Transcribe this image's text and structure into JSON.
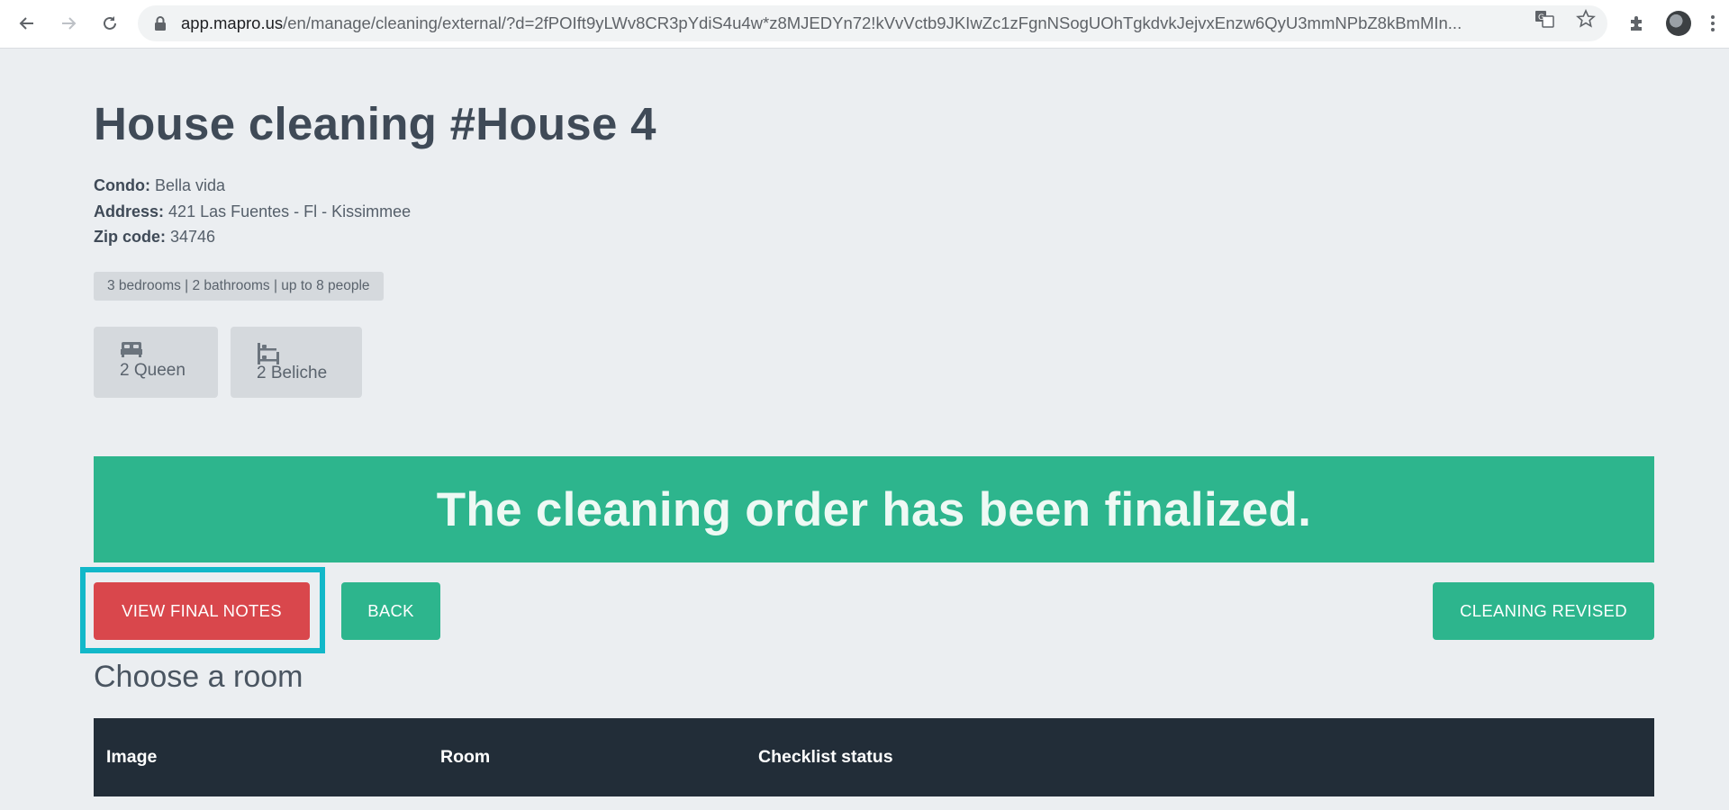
{
  "browser": {
    "url_host": "app.mapro.us",
    "url_path": "/en/manage/cleaning/external/?d=2fPOIft9yLWv8CR3pYdiS4u4w*z8MJEDYn72!kVvVctb9JKIwZc1zFgnNSogUOhTgkdvkJejvxEnzw6QyU3mmNPbZ8kBmMIn..."
  },
  "page": {
    "title": "House cleaning #House 4",
    "condo_label": "Condo:",
    "condo_value": "Bella vida",
    "address_label": "Address:",
    "address_value": "421 Las Fuentes - Fl - Kissimmee",
    "zip_label": "Zip code:",
    "zip_value": "34746",
    "capacity": "3 bedrooms | 2 bathrooms | up to 8 people",
    "beds": [
      {
        "label": "2 Queen",
        "icon": "bed-icon"
      },
      {
        "label": "2 Beliche",
        "icon": "bunk-bed-icon"
      }
    ],
    "banner": "The cleaning order has been finalized.",
    "buttons": {
      "view_final_notes": "VIEW FINAL NOTES",
      "back": "BACK",
      "cleaning_revised": "CLEANING REVISED"
    },
    "section_title": "Choose a room",
    "table": {
      "columns": [
        "Image",
        "Room",
        "Checklist status"
      ]
    }
  },
  "colors": {
    "accent_green": "#2db58d",
    "danger_red": "#d9474c",
    "highlight_cyan": "#12b8c9",
    "table_header": "#222d38"
  }
}
